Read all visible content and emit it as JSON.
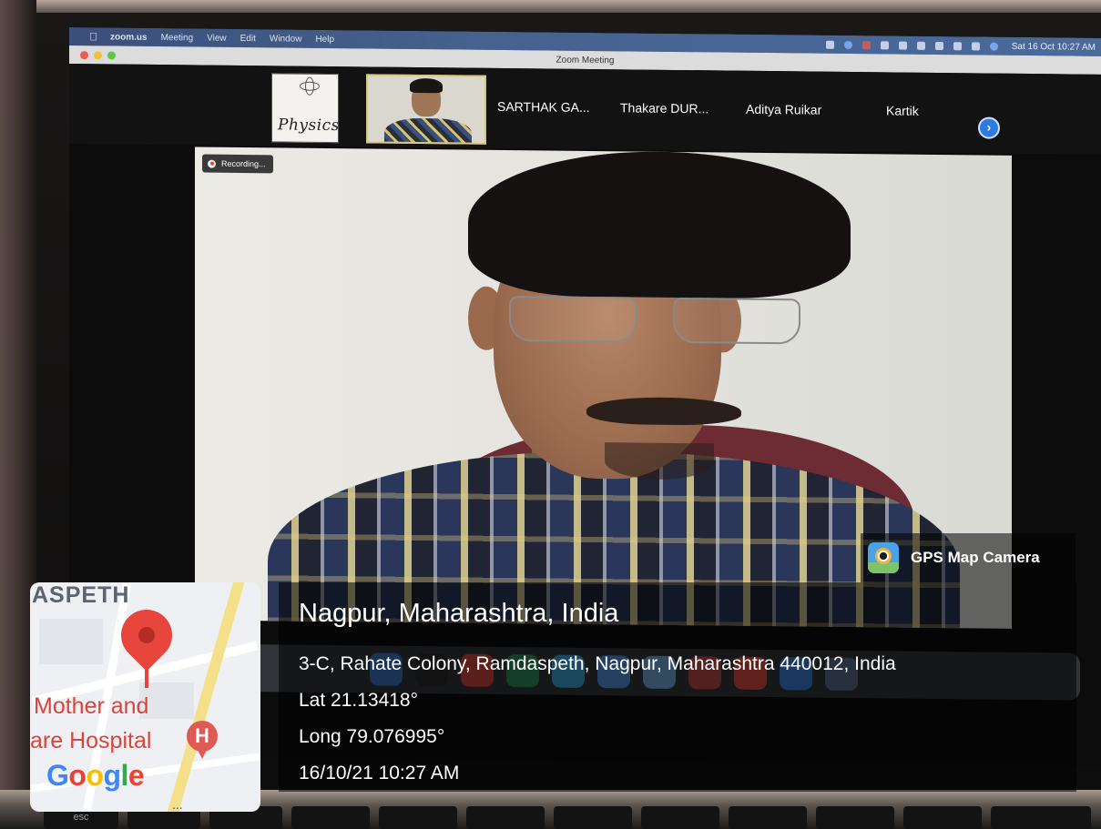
{
  "menubar": {
    "app": "zoom.us",
    "items": [
      "Meeting",
      "View",
      "Edit",
      "Window",
      "Help"
    ],
    "clock": "Sat 16 Oct  10:27 AM"
  },
  "window": {
    "title": "Zoom Meeting"
  },
  "recording": {
    "label": "Recording..."
  },
  "participants": {
    "physics_label": "Physics",
    "names": [
      "SARTHAK GA...",
      "Thakare DUR...",
      "Aditya Ruikar",
      "Kartik"
    ]
  },
  "overlay": {
    "app_name": "GPS Map Camera",
    "city": "Nagpur, Maharashtra, India",
    "address": "3-C, Rahate Colony, Ramdaspeth, Nagpur, Maharashtra 440012, India",
    "lat": "Lat 21.13418°",
    "long": "Long 79.076995°",
    "datetime": "16/10/21 10:27 AM"
  },
  "map": {
    "area": "ASPETH",
    "place_line1": "Mother and",
    "place_line2": "are Hospital",
    "hospital_marker": "H",
    "brand": "Google",
    "more": "..."
  },
  "keyboard": {
    "esc_label": "esc"
  },
  "colors": {
    "accent_blue": "#2e7be0",
    "pin_red": "#e8453c",
    "shirt_navy": "#3c4a72"
  }
}
